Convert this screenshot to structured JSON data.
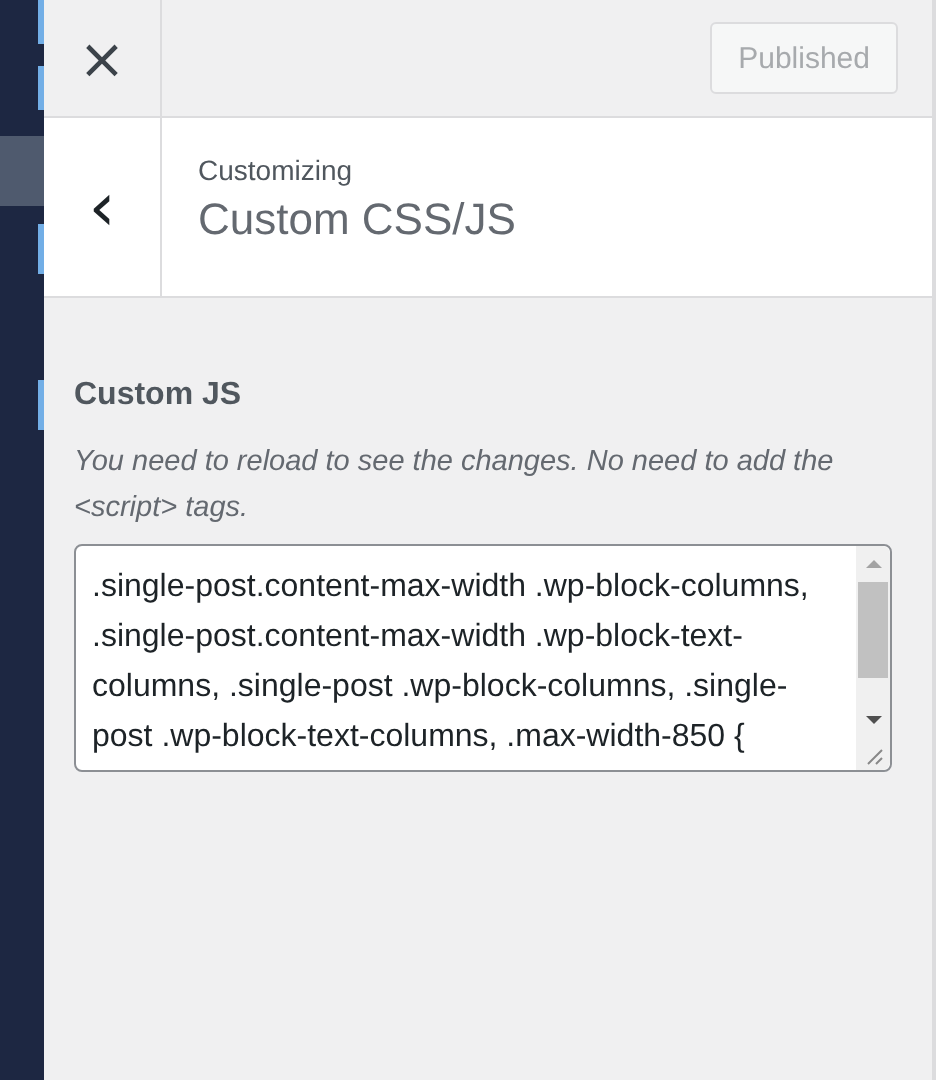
{
  "header": {
    "close_icon": "×",
    "publish_button": {
      "label": "Published",
      "disabled": true
    }
  },
  "section": {
    "back_icon": "‹",
    "breadcrumb": "Customizing",
    "title": "Custom CSS/JS"
  },
  "control": {
    "label": "Custom JS",
    "description": "You need to reload to see the changes. No need to add the <script> tags.",
    "value": ".single-post.content-max-width .wp-block-columns, .single-post.content-max-width .wp-block-text-columns, .single-post .wp-block-columns, .single-post .wp-block-text-columns, .max-width-850 {"
  }
}
